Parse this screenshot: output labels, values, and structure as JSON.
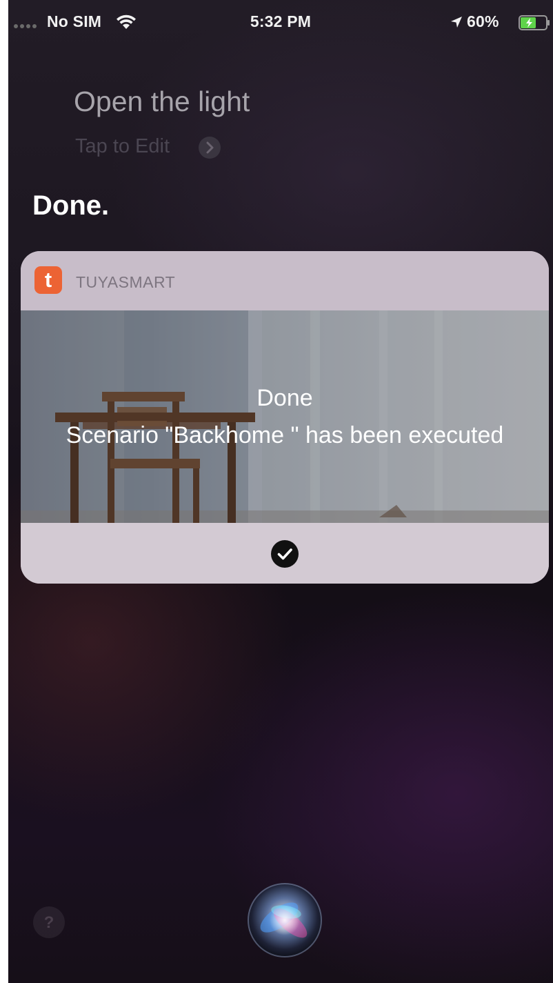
{
  "status_bar": {
    "carrier": "No SIM",
    "time": "5:32 PM",
    "battery_percent": "60%",
    "battery_level": 0.6,
    "icons": [
      "signal-dots-icon",
      "wifi-icon",
      "location-arrow-icon",
      "battery-charging-icon"
    ]
  },
  "siri": {
    "query": "Open the light",
    "tap_to_edit": "Tap to Edit",
    "response": "Done."
  },
  "card": {
    "app_name": "TUYASMART",
    "app_icon_letter": "t",
    "result_title": "Done",
    "result_message": "Scenario \"Backhome \" has been executed",
    "confirm_icon": "checkmark-circle-icon"
  },
  "bottom": {
    "help_label": "?",
    "siri_icon": "siri-orb-icon"
  },
  "colors": {
    "app_icon": "#ec6334",
    "background": "#1c1620",
    "card": "#cfc6cf"
  }
}
